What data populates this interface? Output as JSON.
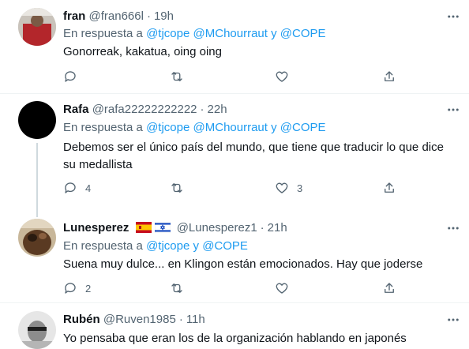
{
  "tweets": [
    {
      "name": "fran",
      "handle": "@fran666l",
      "time": "19h",
      "reply_prefix": "En respuesta a",
      "mentions": [
        "@tjcope",
        "@MChourraut",
        "@COPE"
      ],
      "conj": "y",
      "text": "Gonorreak, kakatua, oing oing",
      "counts": {
        "reply": "",
        "retweet": "",
        "like": ""
      }
    },
    {
      "name": "Rafa",
      "handle": "@rafa22222222222",
      "time": "22h",
      "reply_prefix": "En respuesta a",
      "mentions": [
        "@tjcope",
        "@MChourraut",
        "@COPE"
      ],
      "conj": "y",
      "text": "Debemos ser el único país del mundo, que tiene que traducir lo que dice su medallista",
      "counts": {
        "reply": "4",
        "retweet": "",
        "like": "3"
      }
    },
    {
      "name": "Lunesperez",
      "handle": "@Lunesperez1",
      "time": "21h",
      "reply_prefix": "En respuesta a",
      "mentions": [
        "@tjcope",
        "@COPE"
      ],
      "conj": "y",
      "text": "Suena muy dulce... en Klingon están emocionados. Hay que joderse",
      "counts": {
        "reply": "2",
        "retweet": "",
        "like": ""
      }
    },
    {
      "name": "Rubén",
      "handle": "@Ruven1985",
      "time": "11h",
      "text": "Yo pensaba que eran los de la organización hablando en japonés"
    }
  ],
  "dot": "·",
  "icons": {
    "reply": "reply-icon",
    "retweet": "retweet-icon",
    "like": "heart-icon",
    "share": "share-icon",
    "more": "more-icon",
    "flag1": "spain-flag-icon",
    "flag2": "israel-flag-icon"
  },
  "colors": {
    "link": "#1d9bf0",
    "secondary": "#536471",
    "text": "#0f1419",
    "divider": "#eff3f4"
  }
}
